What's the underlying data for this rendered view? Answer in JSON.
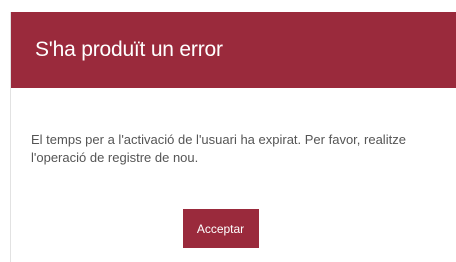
{
  "dialog": {
    "title": "S'ha produït un error",
    "message": "El temps per a l'activació de l'usuari ha expirat. Per favor, realitze l'operació de registre de nou.",
    "accept_label": "Acceptar"
  },
  "colors": {
    "header_background": "#9a2a3c",
    "button_background": "#9a2a3c",
    "title_text": "#ffffff",
    "message_text": "#555555"
  }
}
